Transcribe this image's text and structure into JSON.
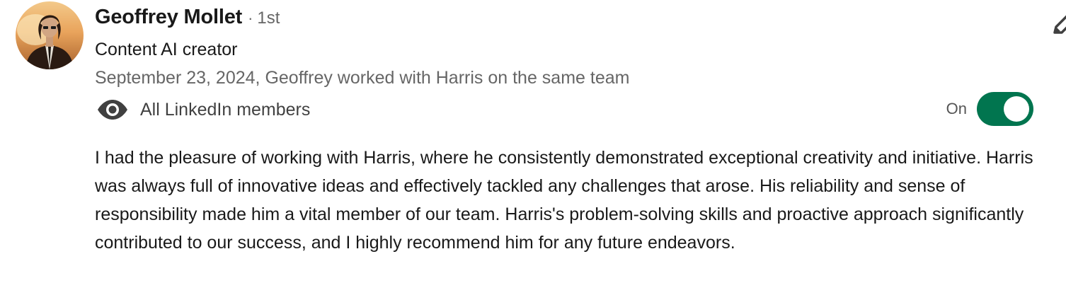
{
  "recommendation": {
    "author_name": "Geoffrey Mollet",
    "degree_separator": "·",
    "connection_degree": "1st",
    "headline": "Content AI creator",
    "meta": "September 23, 2024, Geoffrey worked with Harris on the same team",
    "visibility": {
      "icon": "eye-icon",
      "label": "All LinkedIn members"
    },
    "toggle": {
      "state_label": "On",
      "on": true,
      "color": "#01754f"
    },
    "text": "I had the pleasure of working with Harris, where he consistently demonstrated exceptional creativity and initiative. Harris was always full of innovative ideas and effectively tackled any challenges that arose. His reliability and sense of responsibility made him a vital member of our team. Harris's problem-solving skills and proactive approach significantly contributed to our success, and I highly recommend him for any future endeavors.",
    "edit_icon": "pencil-icon"
  }
}
